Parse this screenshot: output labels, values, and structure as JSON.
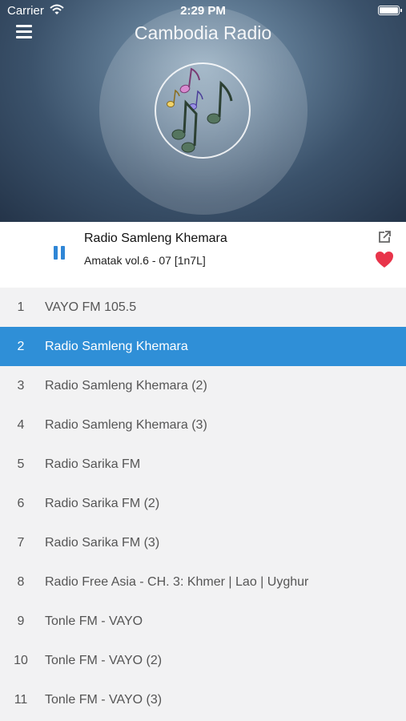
{
  "status_bar": {
    "carrier": "Carrier",
    "time": "2:29 PM"
  },
  "header": {
    "title": "Cambodia Radio"
  },
  "now_playing": {
    "station": "Radio Samleng Khemara",
    "track": "Amatak vol.6 - 07 [1n7L]"
  },
  "colors": {
    "accent": "#2f8fd7",
    "heart": "#e8344a"
  },
  "stations": [
    {
      "num": "1",
      "name": "VAYO FM 105.5"
    },
    {
      "num": "2",
      "name": "Radio Samleng Khemara"
    },
    {
      "num": "3",
      "name": "Radio Samleng Khemara (2)"
    },
    {
      "num": "4",
      "name": "Radio Samleng Khemara (3)"
    },
    {
      "num": "5",
      "name": "Radio Sarika FM"
    },
    {
      "num": "6",
      "name": "Radio Sarika FM (2)"
    },
    {
      "num": "7",
      "name": "Radio Sarika FM (3)"
    },
    {
      "num": "8",
      "name": "Radio Free Asia - CH. 3: Khmer | Lao | Uyghur"
    },
    {
      "num": "9",
      "name": "Tonle FM - VAYO"
    },
    {
      "num": "10",
      "name": "Tonle FM - VAYO (2)"
    },
    {
      "num": "11",
      "name": "Tonle FM - VAYO (3)"
    }
  ],
  "selected_index": 1
}
